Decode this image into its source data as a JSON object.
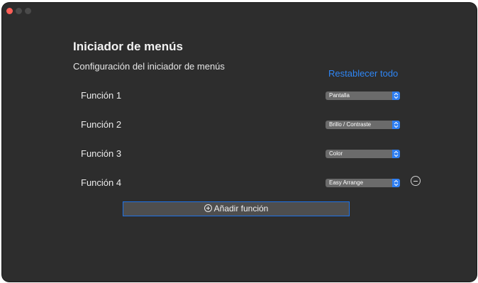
{
  "title": "Iniciador de menús",
  "subtitle": "Configuración del iniciador de menús",
  "reset_label": "Restablecer todo",
  "functions": [
    {
      "label": "Función 1",
      "value": "Pantalla"
    },
    {
      "label": "Función 2",
      "value": "Brillo / Contraste"
    },
    {
      "label": "Función 3",
      "value": "Color"
    },
    {
      "label": "Función 4",
      "value": "Easy Arrange"
    }
  ],
  "add_label": "Añadir función",
  "colors": {
    "window_bg": "#2d2d2d",
    "accent": "#2f86f5",
    "close_dot": "#ff5f57"
  },
  "icons": {
    "add": "plus-circle-icon",
    "remove": "minus-circle-icon",
    "select": "chevron-updown-icon"
  }
}
